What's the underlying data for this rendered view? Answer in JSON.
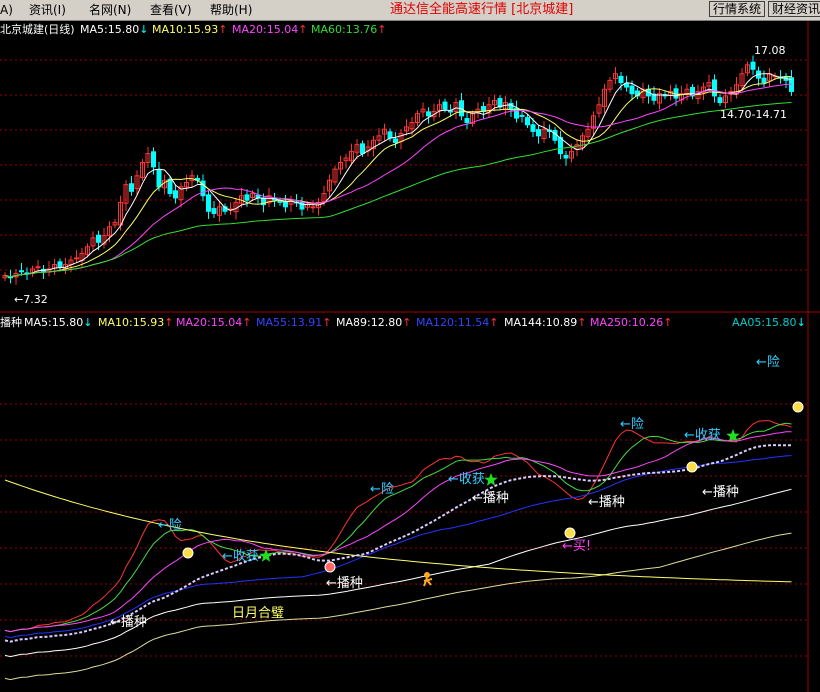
{
  "menu": {
    "item0": "A)",
    "item1": "资讯(I)",
    "item2": "名网(N)",
    "item3": "查看(V)",
    "item4": "帮助(H)"
  },
  "app_title": "通达信全能高速行情 [北京城建]",
  "buttons": {
    "quote_system": "行情系统",
    "finance_info": "财经资讯"
  },
  "upper_panel": {
    "title": "北京城建(日线)",
    "indicators": [
      {
        "text": "MA5:15.80",
        "arrow": "↓",
        "color": "#ffffff"
      },
      {
        "text": "MA10:15.93",
        "arrow": "↑",
        "color": "#ffff66"
      },
      {
        "text": "MA20:15.04",
        "arrow": "↑",
        "color": "#ff44ff"
      },
      {
        "text": "MA60:13.76",
        "arrow": "↑",
        "color": "#33dd33"
      }
    ],
    "annotations": {
      "high": "17.08",
      "range": "14.70-14.71",
      "low": "←7.32"
    }
  },
  "lower_panel": {
    "title": "播种",
    "indicators": [
      {
        "text": "MA5:15.80",
        "arrow": "↓",
        "color": "#ffffff"
      },
      {
        "text": "MA10:15.93",
        "arrow": "↑",
        "color": "#ffff66"
      },
      {
        "text": "MA20:15.04",
        "arrow": "↑",
        "color": "#ff44ff"
      },
      {
        "text": "MA55:13.91",
        "arrow": "↑",
        "color": "#3344ff"
      },
      {
        "text": "MA89:12.80",
        "arrow": "↑",
        "color": "#ffffff"
      },
      {
        "text": "MA120:11.54",
        "arrow": "↑",
        "color": "#3344ff"
      },
      {
        "text": "MA144:10.89",
        "arrow": "↑",
        "color": "#ffffff"
      },
      {
        "text": "MA250:10.26",
        "arrow": "↑",
        "color": "#ff44ff"
      },
      {
        "text": "AA05:15.80",
        "arrow": "↓",
        "color": "#00cccc"
      }
    ],
    "signals": {
      "danger": "←险",
      "harvest": "←收获",
      "sow": "←播种",
      "buy": "←买!",
      "sun_moon": "日月合璧"
    }
  },
  "colors": {
    "up": "#ff3333",
    "down": "#00ffff",
    "ma5": "#ffffff",
    "ma10": "#ffff66",
    "ma20": "#ff44ff",
    "ma60": "#33dd33",
    "grid": "#990000",
    "ma55": "#2233ff",
    "signal_cyan": "#33ccff",
    "signal_yellow": "#ffff66"
  },
  "chart_data": {
    "type": "candlestick",
    "yrange_upper": [
      6.4,
      18.3
    ],
    "closes": [
      7.5,
      7.4,
      7.6,
      7.7,
      7.6,
      7.8,
      7.9,
      7.7,
      7.8,
      8.0,
      7.9,
      8.0,
      8.2,
      8.3,
      8.5,
      8.8,
      9.2,
      9.0,
      9.3,
      9.7,
      9.9,
      10.8,
      11.6,
      11.3,
      12.0,
      12.6,
      13.0,
      12.4,
      11.5,
      11.8,
      11.2,
      11.0,
      11.5,
      11.7,
      12.0,
      11.8,
      11.1,
      10.4,
      10.3,
      10.6,
      10.4,
      10.5,
      10.8,
      11.1,
      10.9,
      11.2,
      11.0,
      10.7,
      11.1,
      10.9,
      10.8,
      10.6,
      10.9,
      10.8,
      10.5,
      10.7,
      10.6,
      10.8,
      11.2,
      11.8,
      12.3,
      12.6,
      12.8,
      13.1,
      13.4,
      13.0,
      13.3,
      13.6,
      13.8,
      14.1,
      13.7,
      13.5,
      13.9,
      14.2,
      14.4,
      14.8,
      15.0,
      14.7,
      14.9,
      15.2,
      15.0,
      14.9,
      15.3,
      14.7,
      14.4,
      14.8,
      15.0,
      14.9,
      15.2,
      15.4,
      15.1,
      15.3,
      15.0,
      14.6,
      14.7,
      14.3,
      14.0,
      13.8,
      14.1,
      14.0,
      13.6,
      13.0,
      12.8,
      13.1,
      13.4,
      13.8,
      14.1,
      14.7,
      15.2,
      15.9,
      16.3,
      16.6,
      16.2,
      16.0,
      15.7,
      15.6,
      15.9,
      15.6,
      15.4,
      15.7,
      15.6,
      15.8,
      15.5,
      15.7,
      15.9,
      15.6,
      15.8,
      16.0,
      16.2,
      15.6,
      15.3,
      15.6,
      15.8,
      16.1,
      16.6,
      17.0,
      16.8,
      16.4,
      16.2,
      16.6,
      16.5,
      16.4,
      16.3,
      15.8
    ]
  }
}
